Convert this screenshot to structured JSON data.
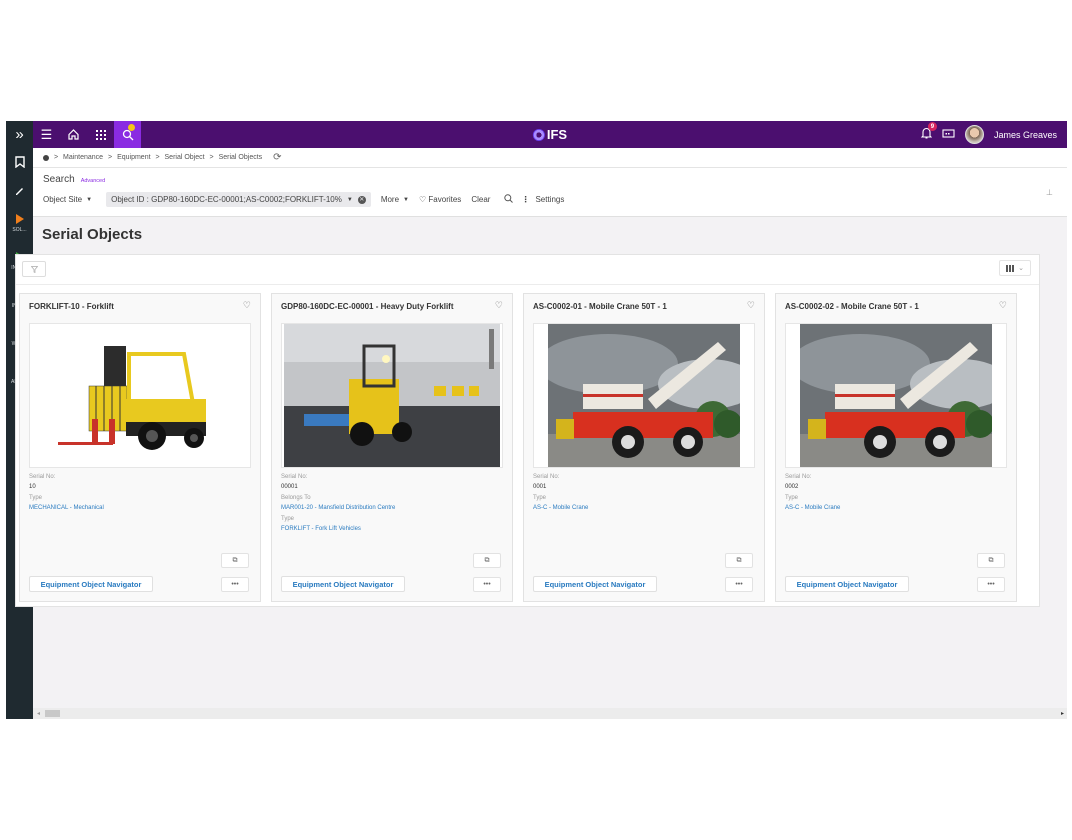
{
  "app": {
    "brand": "IFS",
    "user_name": "James Greaves",
    "notification_count": "9"
  },
  "rail": {
    "expand_icon": "»",
    "items": [
      {
        "label": "SOL...",
        "color": "#f07f1c"
      },
      {
        "label": "INDU...",
        "color": "#3aa83a"
      },
      {
        "label": "INTE...",
        "color": "#c21a7a"
      },
      {
        "label": "Work...",
        "color": "#f5a800"
      },
      {
        "label": "API E...",
        "color": "#f07f1c"
      }
    ]
  },
  "breadcrumb": [
    "Maintenance",
    "Equipment",
    "Serial Object",
    "Serial Objects"
  ],
  "search": {
    "title": "Search",
    "advanced": "Advanced",
    "object_site": "Object Site",
    "object_id_filter": "Object ID : GDP80-160DC-EC-00001;AS-C0002;FORKLIFT-10%",
    "more": "More",
    "favorites": "Favorites",
    "clear": "Clear",
    "settings": "Settings"
  },
  "page": {
    "title": "Serial Objects"
  },
  "cards": [
    {
      "title": "FORKLIFT-10 - Forklift",
      "image": "forklift",
      "fields": [
        {
          "label": "Serial No:",
          "value": "10",
          "link": false
        },
        {
          "label": "Type",
          "value": "MECHANICAL - Mechanical",
          "link": true
        }
      ],
      "nav_label": "Equipment Object Navigator"
    },
    {
      "title": "GDP80-160DC-EC-00001 - Heavy Duty Forklift",
      "image": "heavy-forklift",
      "fields": [
        {
          "label": "Serial No:",
          "value": "00001",
          "link": false
        },
        {
          "label": "Belongs To",
          "value": "MAR001-20 - Mansfield Distribution Centre",
          "link": true
        },
        {
          "label": "Type",
          "value": "FORKLIFT - Fork Lift Vehicles",
          "link": true
        }
      ],
      "nav_label": "Equipment Object Navigator"
    },
    {
      "title": "AS-C0002-01 - Mobile Crane 50T - 1",
      "image": "crane",
      "fields": [
        {
          "label": "Serial No:",
          "value": "0001",
          "link": false
        },
        {
          "label": "Type",
          "value": "AS-C - Mobile Crane",
          "link": true
        }
      ],
      "nav_label": "Equipment Object Navigator"
    },
    {
      "title": "AS-C0002-02 - Mobile Crane 50T - 1",
      "image": "crane",
      "fields": [
        {
          "label": "Serial No:",
          "value": "0002",
          "link": false
        },
        {
          "label": "Type",
          "value": "AS-C - Mobile Crane",
          "link": true
        }
      ],
      "nav_label": "Equipment Object Navigator"
    }
  ],
  "colors": {
    "topbar": "#4b0f6f",
    "accent": "#8a2be2",
    "link": "#2a7bc0",
    "rail": "#1f2a30"
  }
}
